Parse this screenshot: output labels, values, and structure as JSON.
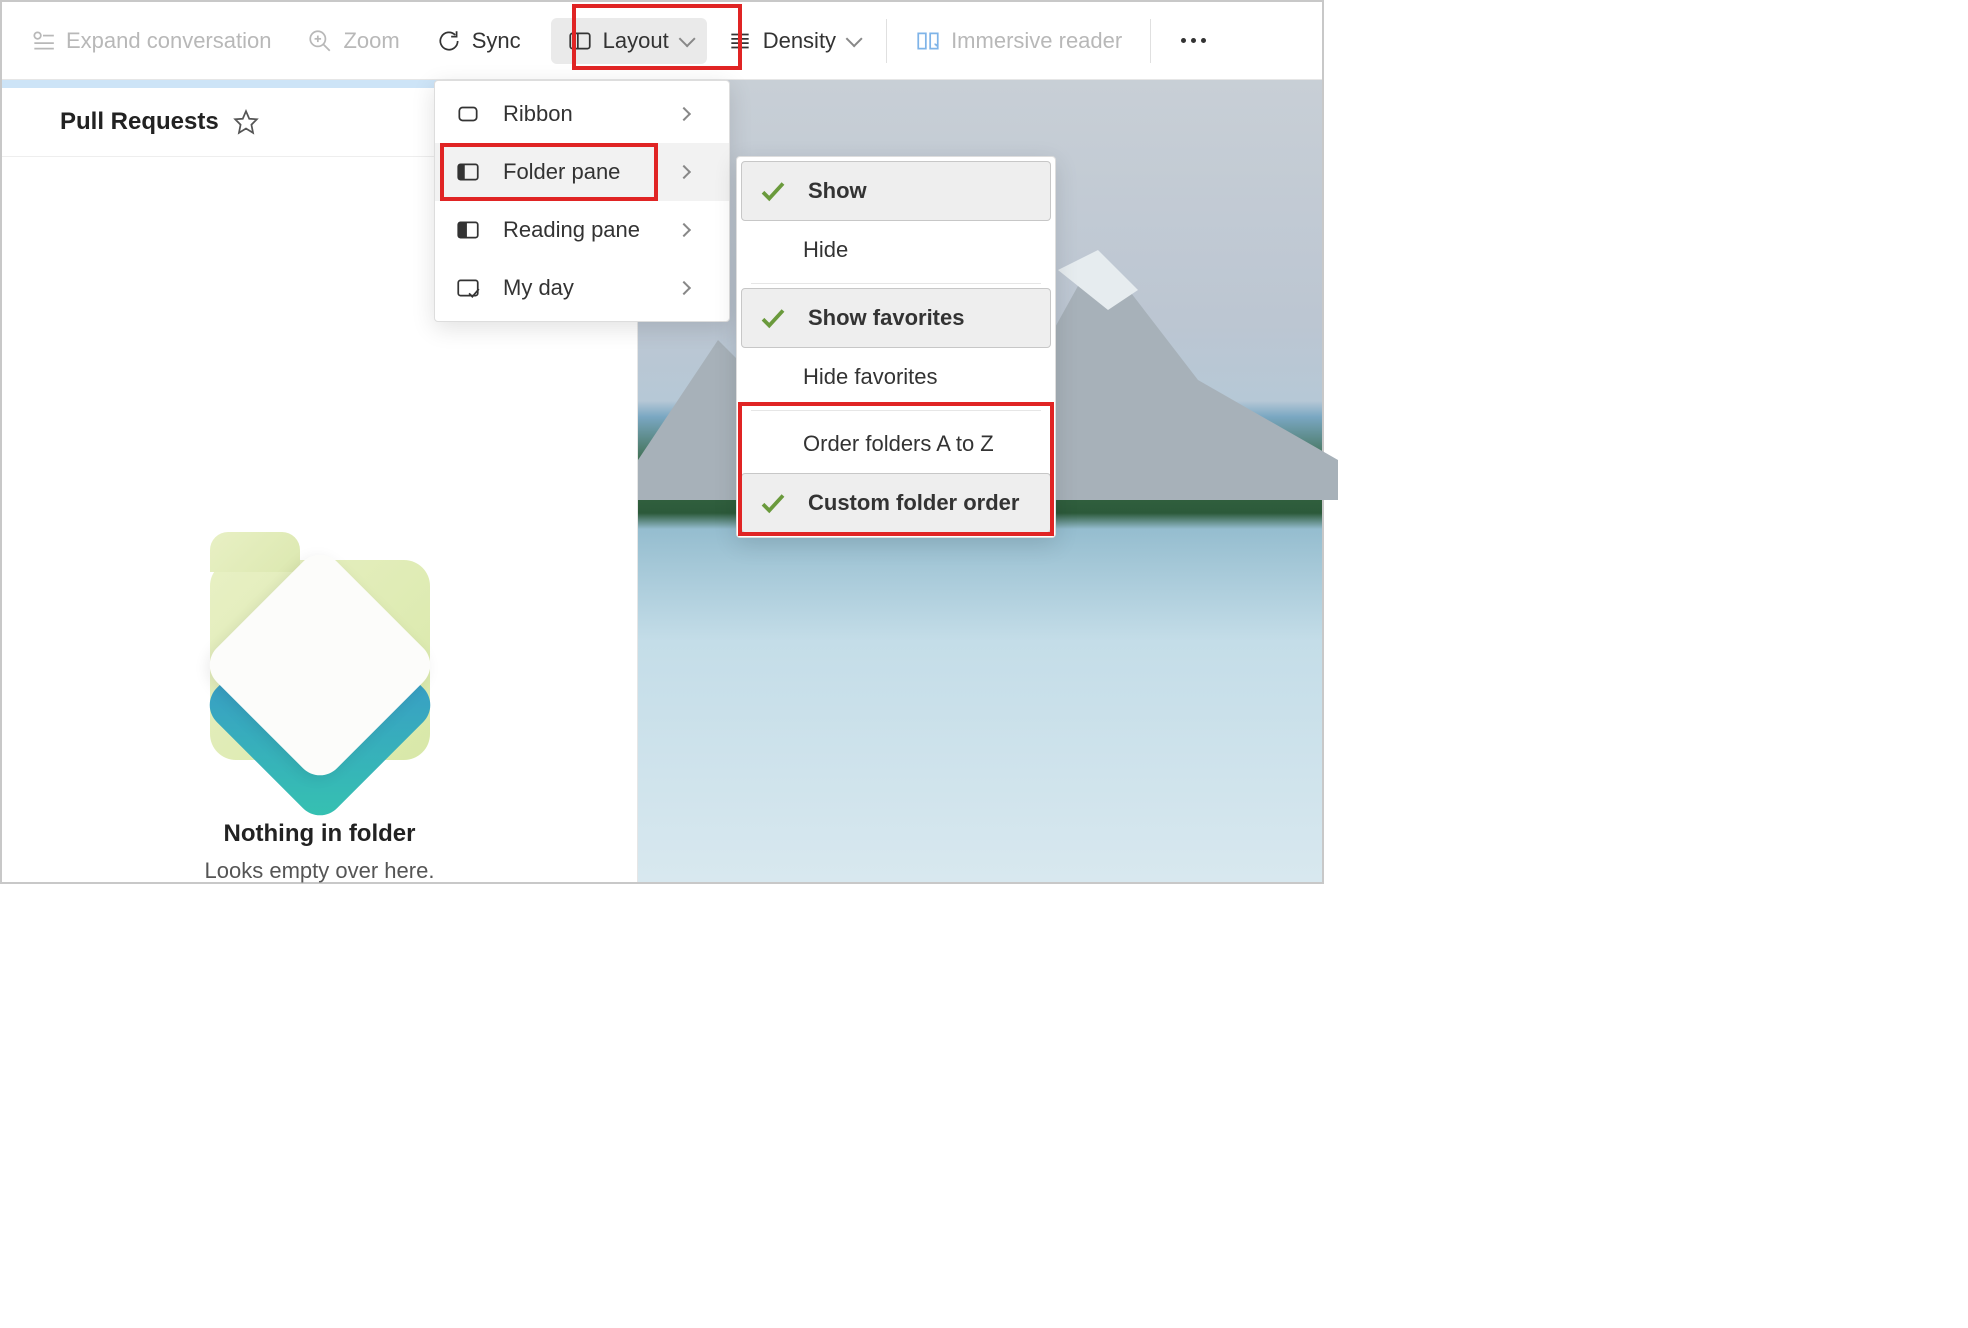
{
  "toolbar": {
    "expand": "Expand conversation",
    "zoom": "Zoom",
    "sync": "Sync",
    "layout": "Layout",
    "density": "Density",
    "immersive": "Immersive reader"
  },
  "folder": {
    "title": "Pull Requests"
  },
  "empty": {
    "title": "Nothing in folder",
    "subtitle": "Looks empty over here."
  },
  "layout_menu": {
    "ribbon": "Ribbon",
    "folder_pane": "Folder pane",
    "reading_pane": "Reading pane",
    "my_day": "My day"
  },
  "folderpane_menu": {
    "show": "Show",
    "hide": "Hide",
    "show_fav": "Show favorites",
    "hide_fav": "Hide favorites",
    "order_az": "Order folders A to Z",
    "custom_order": "Custom folder order"
  }
}
